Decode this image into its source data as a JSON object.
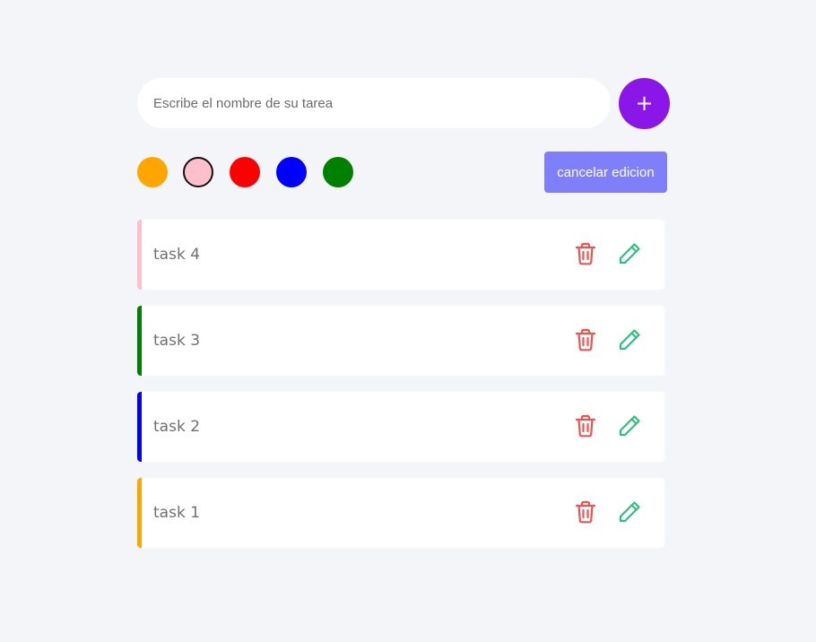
{
  "form": {
    "input_value": "",
    "input_placeholder": "Escribe el nombre de su tarea",
    "add_label": "+",
    "cancel_label": "cancelar edicion"
  },
  "colors": [
    {
      "name": "orange",
      "hex": "#ffa500",
      "selected": false
    },
    {
      "name": "pink",
      "hex": "#ffc0cb",
      "selected": true
    },
    {
      "name": "red",
      "hex": "#ff0000",
      "selected": false
    },
    {
      "name": "blue",
      "hex": "#0000ff",
      "selected": false
    },
    {
      "name": "green",
      "hex": "#008000",
      "selected": false
    }
  ],
  "tasks": [
    {
      "label": "task 4",
      "color": "#ffc0cb"
    },
    {
      "label": "task 3",
      "color": "#008000"
    },
    {
      "label": "task 2",
      "color": "#0000ff"
    },
    {
      "label": "task 1",
      "color": "#ffa500"
    }
  ],
  "icons": {
    "delete": "trash-icon",
    "edit": "pencil-icon",
    "delete_color": "#ef5350",
    "edit_color": "#2ebf7f"
  }
}
